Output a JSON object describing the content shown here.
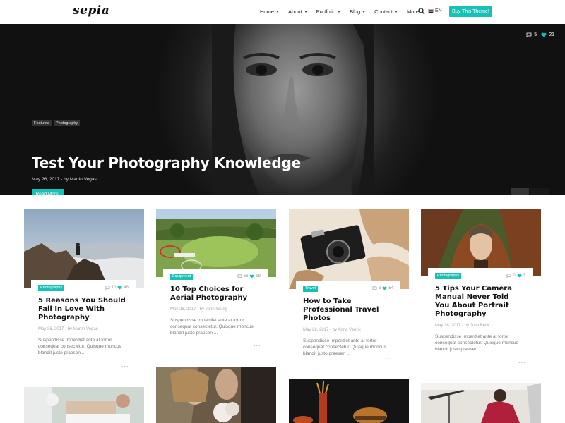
{
  "header": {
    "logo": "sepia",
    "nav": [
      {
        "label": "Home",
        "has_caret": true
      },
      {
        "label": "About",
        "has_caret": true
      },
      {
        "label": "Portfolio",
        "has_caret": true
      },
      {
        "label": "Blog",
        "has_caret": true
      },
      {
        "label": "Contact",
        "has_caret": true
      },
      {
        "label": "More",
        "has_caret": true
      }
    ],
    "search_icon": "search-icon",
    "language": "EN",
    "buy_button": "Buy This Theme!"
  },
  "hero": {
    "comments": "5",
    "likes": "21",
    "tags": [
      "Featured",
      "Photography"
    ],
    "title": "Test Your Photography Knowledge",
    "meta": "May 26, 2017 - by Martin Vegas",
    "read_more": "Read More!"
  },
  "cards": [
    {
      "tag": "Photography",
      "comments": "10",
      "likes": "48",
      "title": "5 Reasons You Should Fall In Love With Photography",
      "meta": "May 26, 2017 - by Martin Vegas",
      "excerpt": "Suspendisse imperdiet ante at tortor consequat consectetur. Quisque rhoncus blandit justo praesen ...",
      "more": "..."
    },
    {
      "tag": "Equipment",
      "comments": "66",
      "likes": "98",
      "title": "10 Top Choices for Aerial Photography",
      "meta": "May 26, 2017 - by John Young",
      "excerpt": "Suspendisse imperdiet ante at tortor consequat consectetur. Quisque rhoncus blandit justo praesen ...",
      "more": "..."
    },
    {
      "tag": "Travel",
      "comments": "3",
      "likes": "54",
      "title": "How to Take Professional Travel Photos",
      "meta": "May 26, 2017 - by Anna Vernik",
      "excerpt": "Suspendisse imperdiet ante at tortor consequat consectetur. Quisque rhoncus blandit justo praesen ...",
      "more": "..."
    },
    {
      "tag": "Photography",
      "comments": "0",
      "likes": "3",
      "title": "5 Tips Your Camera Manual Never Told You About Portrait Photography",
      "meta": "May 26, 2017 - by Julia Beck",
      "excerpt": "Suspendisse imperdiet ante at tortor consequat consectetur. Quisque rhoncus blandit justo praesen ...",
      "more": "..."
    }
  ],
  "colors": {
    "accent": "#17c1b6",
    "heart": "#17c1b6"
  }
}
